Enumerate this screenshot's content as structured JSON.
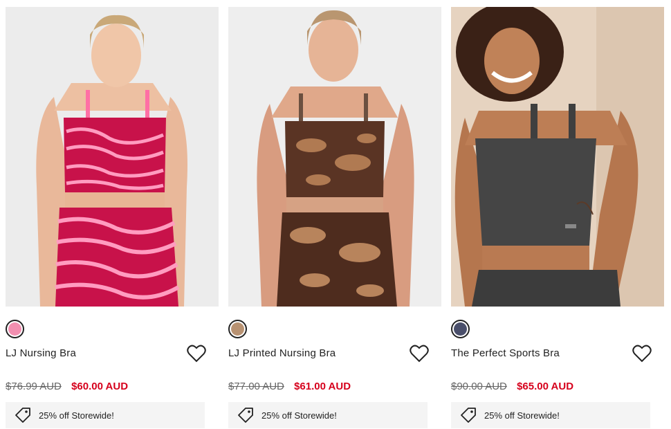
{
  "products": [
    {
      "name": "LJ Nursing Bra",
      "was_price": "$76.99 AUD",
      "now_price": "$60.00 AUD",
      "promo": "25% off Storewide!",
      "swatch_color": "#f28fb0",
      "image": "model-pink-zebra-nursing-bra"
    },
    {
      "name": "LJ Printed Nursing Bra",
      "was_price": "$77.00 AUD",
      "now_price": "$61.00 AUD",
      "promo": "25% off Storewide!",
      "swatch_color": "#b89272",
      "image": "model-brown-camo-nursing-bra"
    },
    {
      "name": "The Perfect Sports Bra",
      "was_price": "$90.00 AUD",
      "now_price": "$65.00 AUD",
      "promo": "25% off Storewide!",
      "swatch_color": "#4a4f6b",
      "image": "model-charcoal-sports-bra"
    }
  ],
  "colors": {
    "sale_price": "#d6001c",
    "promo_bg": "#f4f4f4"
  },
  "icons": {
    "wishlist": "heart-icon",
    "promo": "tag-icon"
  }
}
